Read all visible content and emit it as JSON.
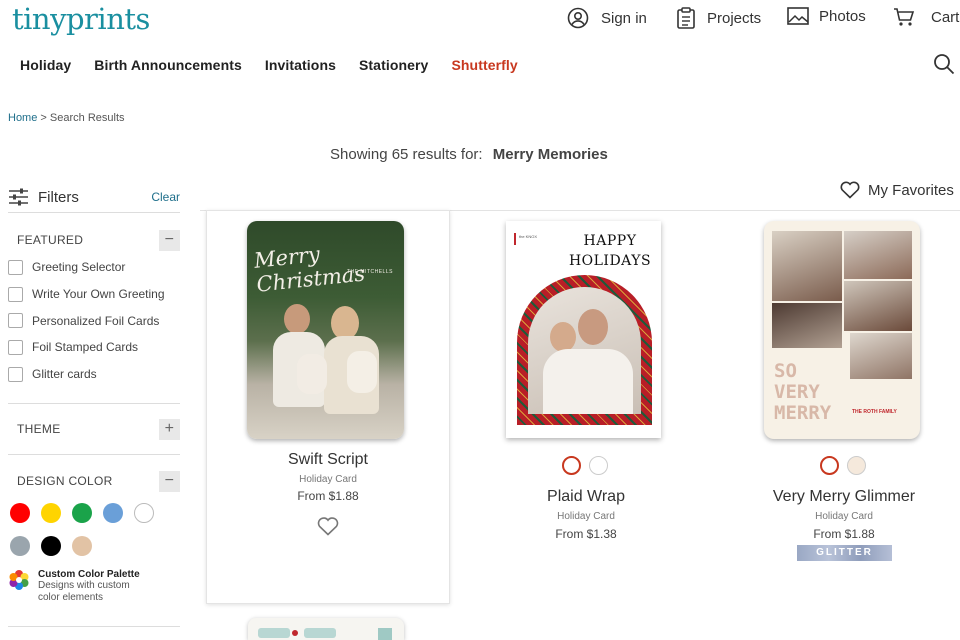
{
  "header": {
    "logo": "tinyprints",
    "signin": "Sign in",
    "projects": "Projects",
    "photos": "Photos",
    "cart": "Cart"
  },
  "nav": [
    "Holiday",
    "Birth Announcements",
    "Invitations",
    "Stationery",
    "Shutterfly"
  ],
  "breadcrumb": {
    "home": "Home",
    "sep": ">",
    "current": "Search Results"
  },
  "results": {
    "prefix": "Showing 65 results for:",
    "query": "Merry Memories"
  },
  "filters": {
    "title": "Filters",
    "clear": "Clear",
    "featured": {
      "title": "FEATURED",
      "items": [
        "Greeting Selector",
        "Write Your Own Greeting",
        "Personalized Foil Cards",
        "Foil Stamped Cards",
        "Glitter cards"
      ]
    },
    "theme": {
      "title": "THEME"
    },
    "design_color": {
      "title": "DESIGN COLOR",
      "swatches": [
        "#ff0000",
        "#ffd400",
        "#1aa34a",
        "#6a9fd8",
        "#ffffff",
        "#9aa5ad",
        "#000000",
        "#e2c3a5"
      ],
      "palette_title": "Custom Color Palette",
      "palette_desc": "Designs with custom color elements"
    }
  },
  "favorites": "My Favorites",
  "products": [
    {
      "name": "Swift Script",
      "type": "Holiday Card",
      "price": "From $1.88",
      "card_text": "Merry Christmas",
      "family": "THE MITCHELLS"
    },
    {
      "name": "Plaid Wrap",
      "type": "Holiday Card",
      "price": "From $1.38",
      "card_text": "HAPPY HOLIDAYS",
      "brand": "the KNOX"
    },
    {
      "name": "Very Merry Glimmer",
      "type": "Holiday Card",
      "price": "From $1.88",
      "card_text": "SO VERY MERRY",
      "family": "THE ROTH FAMILY",
      "badge": "GLITTER"
    }
  ],
  "colors": {
    "accent": "#1a8fa0",
    "shutterfly": "#c8381f",
    "link": "#1f6f8b"
  }
}
